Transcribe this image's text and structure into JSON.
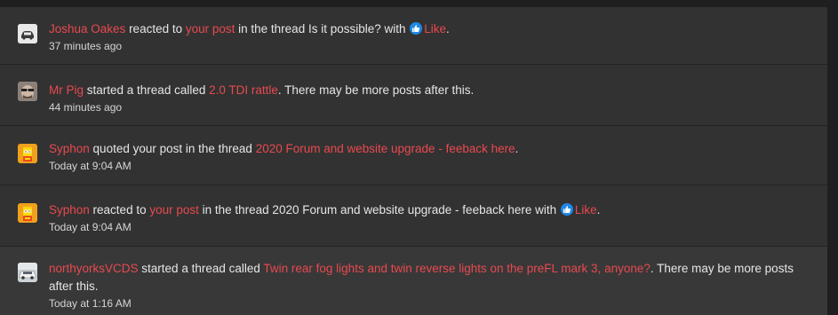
{
  "alerts": [
    {
      "user": "Joshua Oakes",
      "t1": " reacted to ",
      "link1": "your post",
      "t2": " in the thread Is it possible? with ",
      "reaction": "Like",
      "t3": ".",
      "time": "37 minutes ago",
      "avatar": "car-icon"
    },
    {
      "user": "Mr Pig",
      "t1": " started a thread called ",
      "link1": "2.0 TDI rattle",
      "t2": ". There may be more posts after this.",
      "time": "44 minutes ago",
      "avatar": "face-icon"
    },
    {
      "user": "Syphon",
      "t1": " quoted your post in the thread ",
      "link1": "2020 Forum and website upgrade - feeback here",
      "t2": ".",
      "time": "Today at 9:04 AM",
      "avatar": "bart-icon"
    },
    {
      "user": "Syphon",
      "t1": " reacted to ",
      "link1": "your post",
      "t2": " in the thread 2020 Forum and website upgrade - feeback here with ",
      "reaction": "Like",
      "t3": ".",
      "time": "Today at 9:04 AM",
      "avatar": "bart-icon"
    },
    {
      "user": "northyorksVCDS",
      "t1": " started a thread called ",
      "link1": "Twin rear fog lights and twin reverse lights on the preFL mark 3, anyone?",
      "t2": ". There may be more posts after this.",
      "time": "Today at 1:16 AM",
      "avatar": "car-photo-icon"
    }
  ],
  "colors": {
    "link": "#e8494f",
    "background": "#323232",
    "like_badge": "#1e88e5"
  }
}
